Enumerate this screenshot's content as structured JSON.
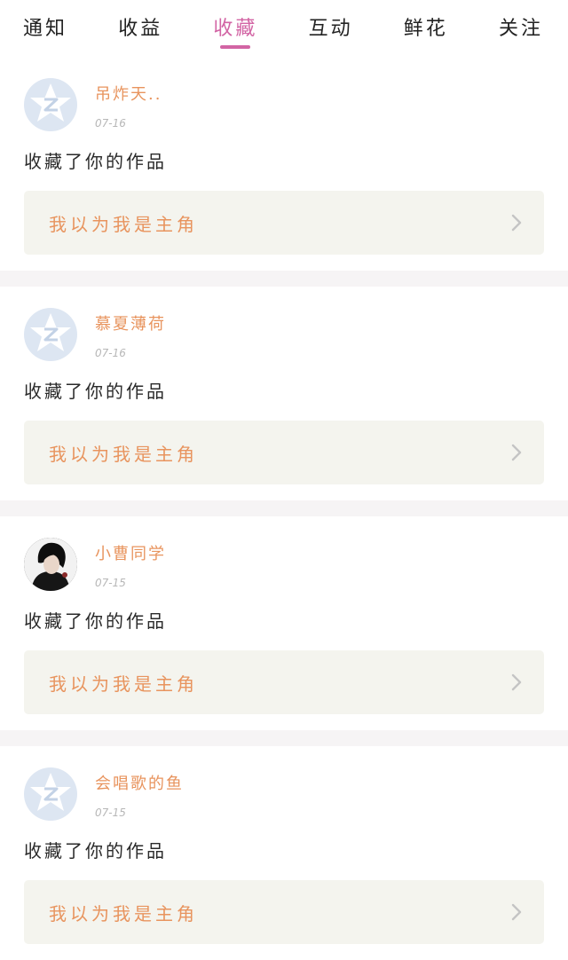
{
  "tabs": [
    {
      "label": "通知"
    },
    {
      "label": "收益"
    },
    {
      "label": "收藏",
      "active": true
    },
    {
      "label": "互动"
    },
    {
      "label": "鲜花"
    },
    {
      "label": "关注"
    }
  ],
  "colors": {
    "accent": "#d264a4",
    "name": "#e8945e",
    "card_bg": "#f4f4ee"
  },
  "feed": [
    {
      "user": "吊炸天..",
      "date": "07-16",
      "avatar": "default-avatar-icon",
      "action": "收藏了你的作品",
      "work_title": "我以为我是主角"
    },
    {
      "user": "慕夏薄荷",
      "date": "07-16",
      "avatar": "default-avatar-icon",
      "action": "收藏了你的作品",
      "work_title": "我以为我是主角"
    },
    {
      "user": "小曹同学",
      "date": "07-15",
      "avatar": "user-photo",
      "action": "收藏了你的作品",
      "work_title": "我以为我是主角"
    },
    {
      "user": "会唱歌的鱼",
      "date": "07-15",
      "avatar": "default-avatar-icon",
      "action": "收藏了你的作品",
      "work_title": "我以为我是主角"
    }
  ]
}
